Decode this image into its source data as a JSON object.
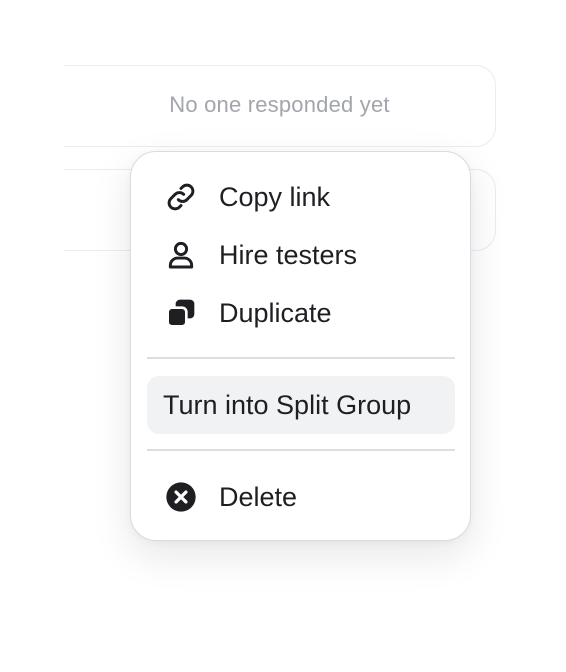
{
  "cards": {
    "empty_message": "No one responded yet"
  },
  "menu": {
    "items": [
      {
        "id": "copy-link",
        "label": "Copy link",
        "icon": "link-icon"
      },
      {
        "id": "hire-testers",
        "label": "Hire testers",
        "icon": "user-icon"
      },
      {
        "id": "duplicate",
        "label": "Duplicate",
        "icon": "duplicate-icon"
      },
      {
        "id": "split-group",
        "label": "Turn into Split Group",
        "icon": "",
        "highlighted": true
      },
      {
        "id": "delete",
        "label": "Delete",
        "icon": "close-circle-icon"
      }
    ]
  },
  "colors": {
    "text": "#1f1f23",
    "muted_text": "#a3a5ad",
    "highlight_bg": "#f1f2f4",
    "divider": "#dddee2",
    "border": "#dadbe0"
  }
}
